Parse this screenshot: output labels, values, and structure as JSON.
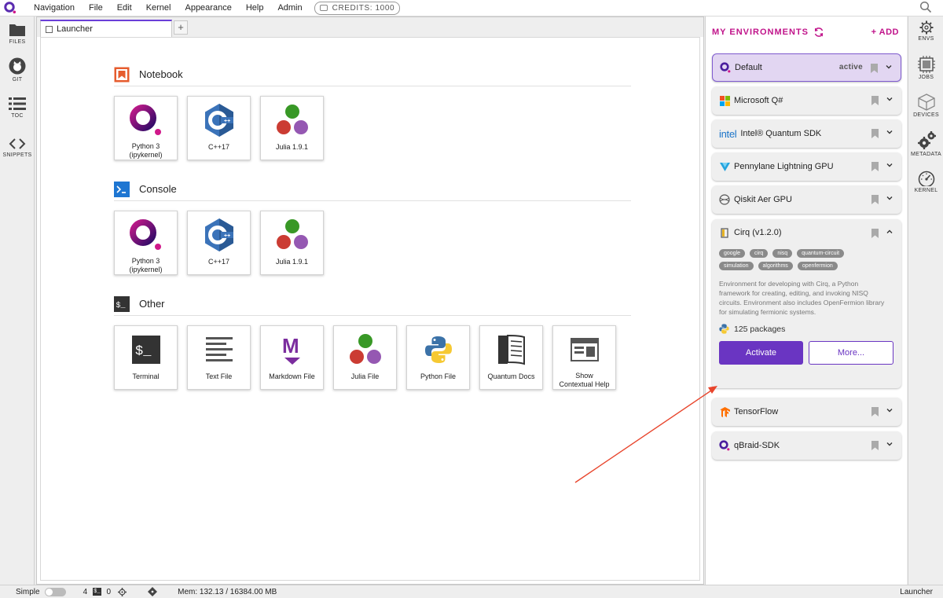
{
  "menubar": {
    "items": [
      "Navigation",
      "File",
      "Edit",
      "Kernel",
      "Appearance",
      "Help",
      "Admin"
    ],
    "credits_label": "CREDITS:",
    "credits_value": "1000"
  },
  "left_sidebar": {
    "files": "FILES",
    "git": "GIT",
    "toc": "TOC",
    "snippets": "SNIPPETS"
  },
  "tabs": {
    "launcher": "Launcher",
    "add": "+"
  },
  "launcher": {
    "notebook": {
      "title": "Notebook",
      "cards": [
        {
          "line1": "Python 3",
          "line2": "(ipykernel)"
        },
        {
          "line1": "C++17",
          "line2": ""
        },
        {
          "line1": "Julia 1.9.1",
          "line2": ""
        }
      ]
    },
    "console": {
      "title": "Console",
      "cards": [
        {
          "line1": "Python 3",
          "line2": "(ipykernel)"
        },
        {
          "line1": "C++17",
          "line2": ""
        },
        {
          "line1": "Julia 1.9.1",
          "line2": ""
        }
      ]
    },
    "other": {
      "title": "Other",
      "cards": [
        {
          "line1": "Terminal",
          "line2": ""
        },
        {
          "line1": "Text File",
          "line2": ""
        },
        {
          "line1": "Markdown File",
          "line2": ""
        },
        {
          "line1": "Julia File",
          "line2": ""
        },
        {
          "line1": "Python File",
          "line2": ""
        },
        {
          "line1": "Quantum Docs",
          "line2": ""
        },
        {
          "line1": "Show",
          "line2": "Contextual Help"
        }
      ]
    }
  },
  "env_panel": {
    "title": "MY ENVIRONMENTS",
    "add": "+ ADD",
    "active_label": "active",
    "envs": [
      {
        "name": "Default"
      },
      {
        "name": "Microsoft Q#"
      },
      {
        "name": "Intel® Quantum SDK"
      },
      {
        "name": "Pennylane Lightning GPU"
      },
      {
        "name": "Qiskit Aer GPU"
      },
      {
        "name": "Cirq (v1.2.0)"
      },
      {
        "name": "TensorFlow"
      },
      {
        "name": "qBraid-SDK"
      }
    ],
    "intel_logo": "intel",
    "cirq": {
      "tags": [
        "google",
        "cirq",
        "nisq",
        "quantum-circuit",
        "simulation",
        "algorithms",
        "openfermion"
      ],
      "description": "Environment for developing with Cirq, a Python framework for creating, editing, and invoking NISQ circuits. Environment also includes OpenFermion library for simulating fermionic systems.",
      "packages": "125 packages",
      "activate": "Activate",
      "more": "More..."
    }
  },
  "right_sidebar": {
    "envs": "ENVS",
    "jobs": "JOBS",
    "devices": "DEVICES",
    "metadata": "METADATA",
    "kernel": "KERNEL"
  },
  "statusbar": {
    "simple": "Simple",
    "count_a": "4",
    "terminal_glyph": "$_",
    "count_b": "0",
    "mem": "Mem: 132.13 / 16384.00 MB",
    "right": "Launcher"
  },
  "colors": {
    "accent": "#6a35c2",
    "brand_pink": "#c0138a",
    "annotation_arrow": "#e8452c"
  }
}
